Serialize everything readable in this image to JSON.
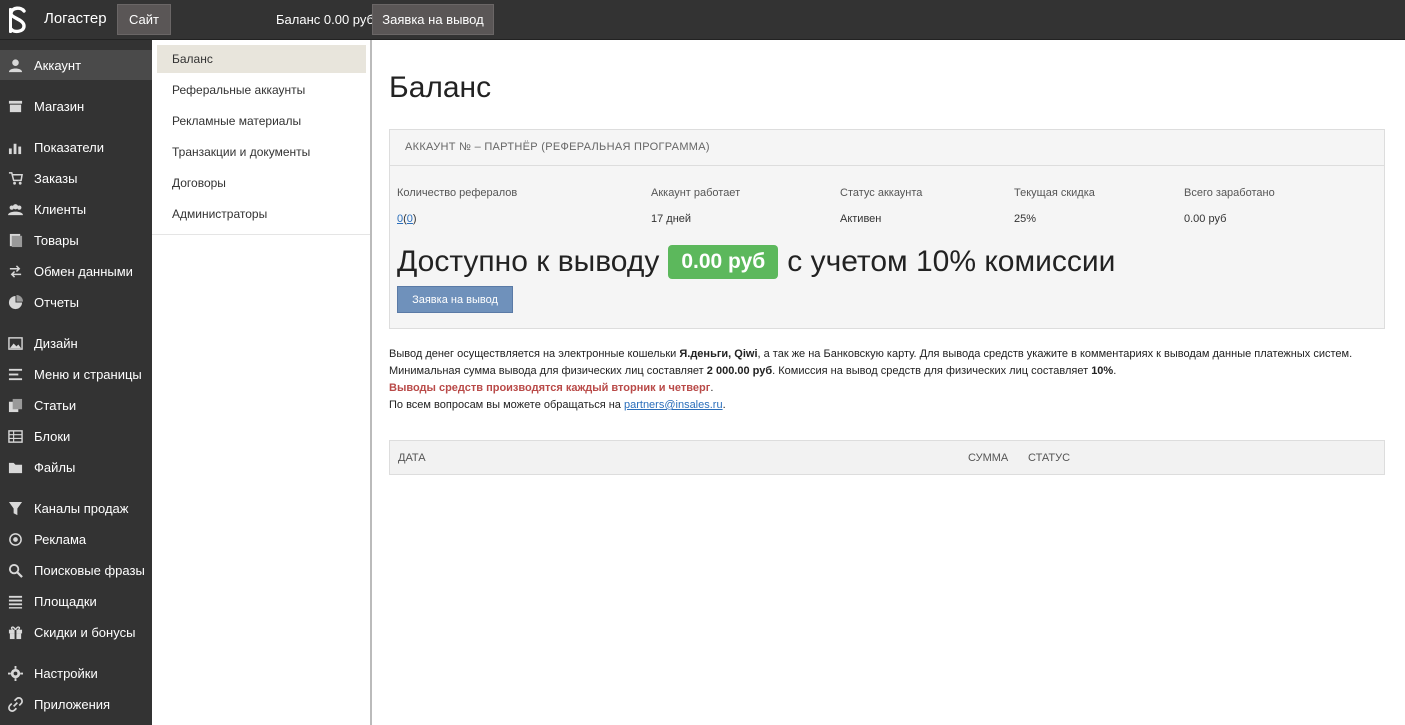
{
  "topbar": {
    "app_name": "Логастер",
    "site_button": "Сайт",
    "balance": "Баланс 0.00 руб",
    "withdraw_button": "Заявка на вывод"
  },
  "sidebar": {
    "items": [
      {
        "label": "Аккаунт",
        "icon": "user-icon"
      },
      {
        "label": "Магазин",
        "icon": "store-icon"
      },
      {
        "label": "Показатели",
        "icon": "bar-chart-icon"
      },
      {
        "label": "Заказы",
        "icon": "cart-icon"
      },
      {
        "label": "Клиенты",
        "icon": "users-icon"
      },
      {
        "label": "Товары",
        "icon": "products-icon"
      },
      {
        "label": "Обмен данными",
        "icon": "exchange-icon"
      },
      {
        "label": "Отчеты",
        "icon": "pie-chart-icon"
      },
      {
        "label": "Дизайн",
        "icon": "image-icon"
      },
      {
        "label": "Меню и страницы",
        "icon": "menu-icon"
      },
      {
        "label": "Статьи",
        "icon": "copy-icon"
      },
      {
        "label": "Блоки",
        "icon": "table-icon"
      },
      {
        "label": "Файлы",
        "icon": "folder-icon"
      },
      {
        "label": "Каналы продаж",
        "icon": "filter-icon"
      },
      {
        "label": "Реклама",
        "icon": "target-icon"
      },
      {
        "label": "Поисковые фразы",
        "icon": "search-icon"
      },
      {
        "label": "Площадки",
        "icon": "list-icon"
      },
      {
        "label": "Скидки и бонусы",
        "icon": "gift-icon"
      },
      {
        "label": "Настройки",
        "icon": "gear-icon"
      },
      {
        "label": "Приложения",
        "icon": "link-icon"
      }
    ]
  },
  "subnav": {
    "items": [
      {
        "label": "Баланс"
      },
      {
        "label": "Реферальные аккаунты"
      },
      {
        "label": "Рекламные материалы"
      },
      {
        "label": "Транзакции и документы"
      },
      {
        "label": "Договоры"
      },
      {
        "label": "Администраторы"
      }
    ]
  },
  "main": {
    "title": "Баланс",
    "panel": {
      "heading": "АККАУНТ № – ПАРТНЁР (РЕФЕРАЛЬНАЯ ПРОГРАММА)",
      "stats": [
        {
          "label": "Количество рефералов"
        },
        {
          "label": "Аккаунт работает",
          "value": "17 дней"
        },
        {
          "label": "Статус аккаунта",
          "value": "Активен"
        },
        {
          "label": "Текущая скидка",
          "value": "25%"
        },
        {
          "label": "Всего заработано",
          "value": "0.00 руб"
        }
      ],
      "referrals_count": "0",
      "referrals_open": "(",
      "referrals_active": "0",
      "referrals_close": ")",
      "available_prefix": "Доступно к выводу",
      "available_amount": "0.00 руб",
      "available_suffix": "с учетом 10% комиссии",
      "withdraw_button": "Заявка на вывод"
    },
    "info": {
      "line1_a": "Вывод денег осуществляется на электронные кошельки ",
      "line1_bold": "Я.деньги, Qiwi",
      "line1_b": ", а так же на Банковскую карту. Для вывода средств укажите в комментариях к выводам данные платежных систем.",
      "line2_a": "Минимальная сумма вывода для физических лиц составляет ",
      "line2_bold1": "2 000.00 руб",
      "line2_b": ". Комиссия на вывод средств для физических лиц составляет ",
      "line2_bold2": "10%",
      "line2_c": ".",
      "line3_red": "Выводы средств производятся каждый вторник и четверг",
      "line3_c": ".",
      "line4_a": "По всем вопросам вы можете обращаться на ",
      "line4_link": "partners@insales.ru",
      "line4_c": "."
    },
    "table": {
      "columns": [
        "ДАТА",
        "СУММА",
        "СТАТУС"
      ]
    }
  }
}
